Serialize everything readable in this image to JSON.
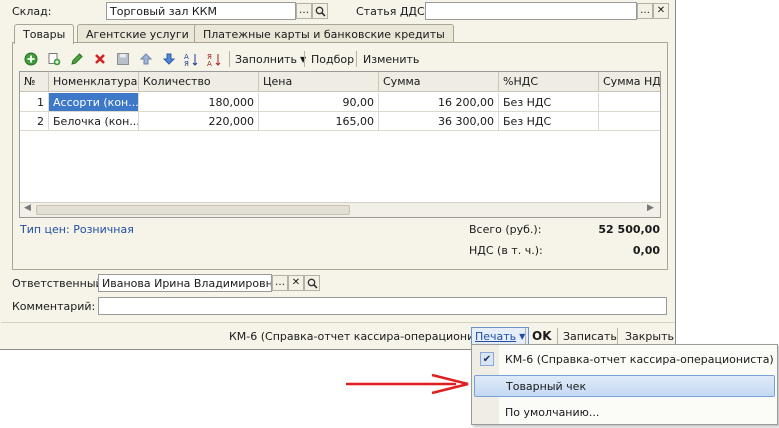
{
  "header": {
    "warehouse_label": "Склад:",
    "warehouse_value": "Торговый зал ККМ",
    "cashflow_label": "Статья ДДС:",
    "cashflow_value": ""
  },
  "tabs": [
    {
      "label": "Товары",
      "active": true
    },
    {
      "label": "Агентские услуги",
      "active": false
    },
    {
      "label": "Платежные карты и банковские кредиты",
      "active": false
    }
  ],
  "toolbar": {
    "icons": [
      "add-icon",
      "copy-icon",
      "edit-icon",
      "delete-icon",
      "save-icon",
      "move-up-icon",
      "move-down-icon",
      "sort-asc-icon",
      "sort-desc-icon"
    ],
    "fill_label": "Заполнить",
    "pick_label": "Подбор",
    "change_label": "Изменить"
  },
  "table": {
    "columns": [
      "№",
      "Номенклатура",
      "Количество",
      "Цена",
      "Сумма",
      "%НДС",
      "Сумма НДС"
    ],
    "rows": [
      [
        "1",
        "Ассорти (кон...",
        "180,000",
        "90,00",
        "16 200,00",
        "Без НДС",
        ""
      ],
      [
        "2",
        "Белочка (кон...",
        "220,000",
        "165,00",
        "36 300,00",
        "Без НДС",
        ""
      ]
    ]
  },
  "price_type": "Тип цен: Розничная",
  "totals": {
    "total_label": "Всего (руб.):",
    "total_value": "52 500,00",
    "vat_label": "НДС (в т. ч.):",
    "vat_value": "0,00"
  },
  "responsible": {
    "label": "Ответственный:",
    "value": "Иванова Ирина Владимировна"
  },
  "comment": {
    "label": "Комментарий:",
    "value": ""
  },
  "bottom": {
    "report_link": "КМ-6 (Справка-отчет кассира-операциониста)",
    "print_label": "Печать",
    "ok_label": "OK",
    "save_label": "Записать",
    "close_label": "Закрыть"
  },
  "print_menu": {
    "items": [
      {
        "label": "КМ-6 (Справка-отчет кассира-операциониста)",
        "checked": true
      },
      {
        "label": "Товарный чек",
        "checked": false
      },
      {
        "label": "По умолчанию...",
        "checked": false
      }
    ]
  },
  "colors": {
    "selection": "#3d78c9",
    "link": "#1f4ea3",
    "arrow": "#e02020"
  }
}
